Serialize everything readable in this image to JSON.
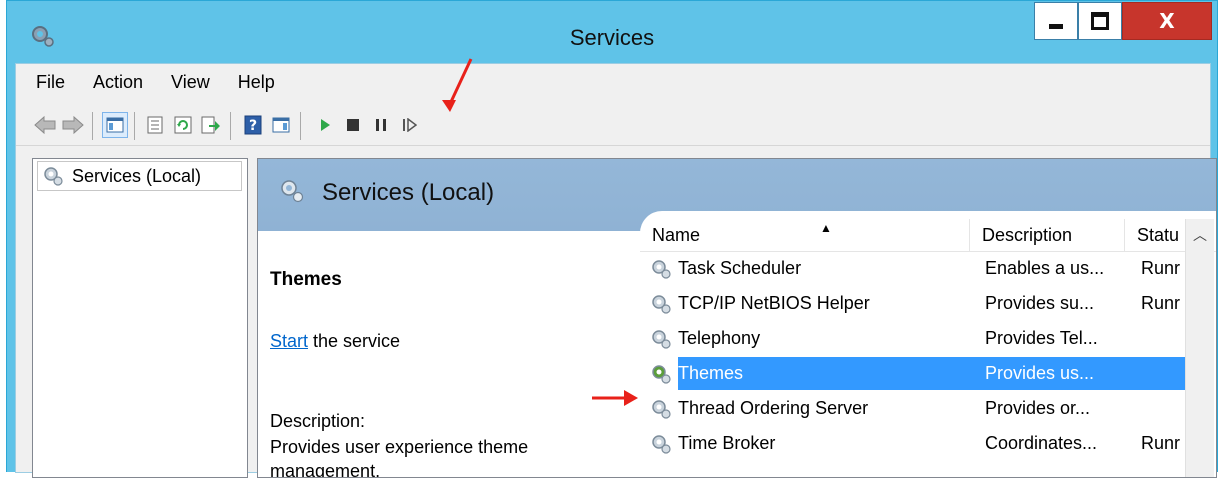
{
  "window": {
    "title": "Services"
  },
  "menu": [
    "File",
    "Action",
    "View",
    "Help"
  ],
  "toolbar": {
    "icons": [
      "back-arrow-icon",
      "forward-arrow-icon",
      "show-hide-console-tree-icon",
      "properties-icon",
      "refresh-icon",
      "export-list-icon",
      "help-icon",
      "show-hide-action-pane-icon",
      "start-service-icon",
      "stop-service-icon",
      "pause-service-icon",
      "resume-service-icon"
    ]
  },
  "tree": {
    "root_label": "Services (Local)"
  },
  "header": {
    "title": "Services (Local)"
  },
  "detail": {
    "service_name": "Themes",
    "start_link": "Start",
    "start_suffix": " the service",
    "description_label": "Description:",
    "description": "Provides user experience theme management."
  },
  "list": {
    "columns": [
      "Name",
      "Description",
      "Status"
    ],
    "header_status_visible": "Statu",
    "rows": [
      {
        "name": "Task Scheduler",
        "description": "Enables a us...",
        "status": "Runr",
        "selected": false
      },
      {
        "name": "TCP/IP NetBIOS Helper",
        "description": "Provides su...",
        "status": "Runr",
        "selected": false
      },
      {
        "name": "Telephony",
        "description": "Provides Tel...",
        "status": "",
        "selected": false
      },
      {
        "name": "Themes",
        "description": "Provides us...",
        "status": "",
        "selected": true
      },
      {
        "name": "Thread Ordering Server",
        "description": "Provides or...",
        "status": "",
        "selected": false
      },
      {
        "name": "Time Broker",
        "description": "Coordinates...",
        "status": "Runr",
        "selected": false
      }
    ]
  },
  "colors": {
    "title_bar": "#5fc3e8",
    "close_button": "#c7352c",
    "selection": "#3399ff",
    "pane_header": "#94b7d8",
    "annotation_arrow": "#e8211a",
    "start_icon": "#2ea84a"
  }
}
